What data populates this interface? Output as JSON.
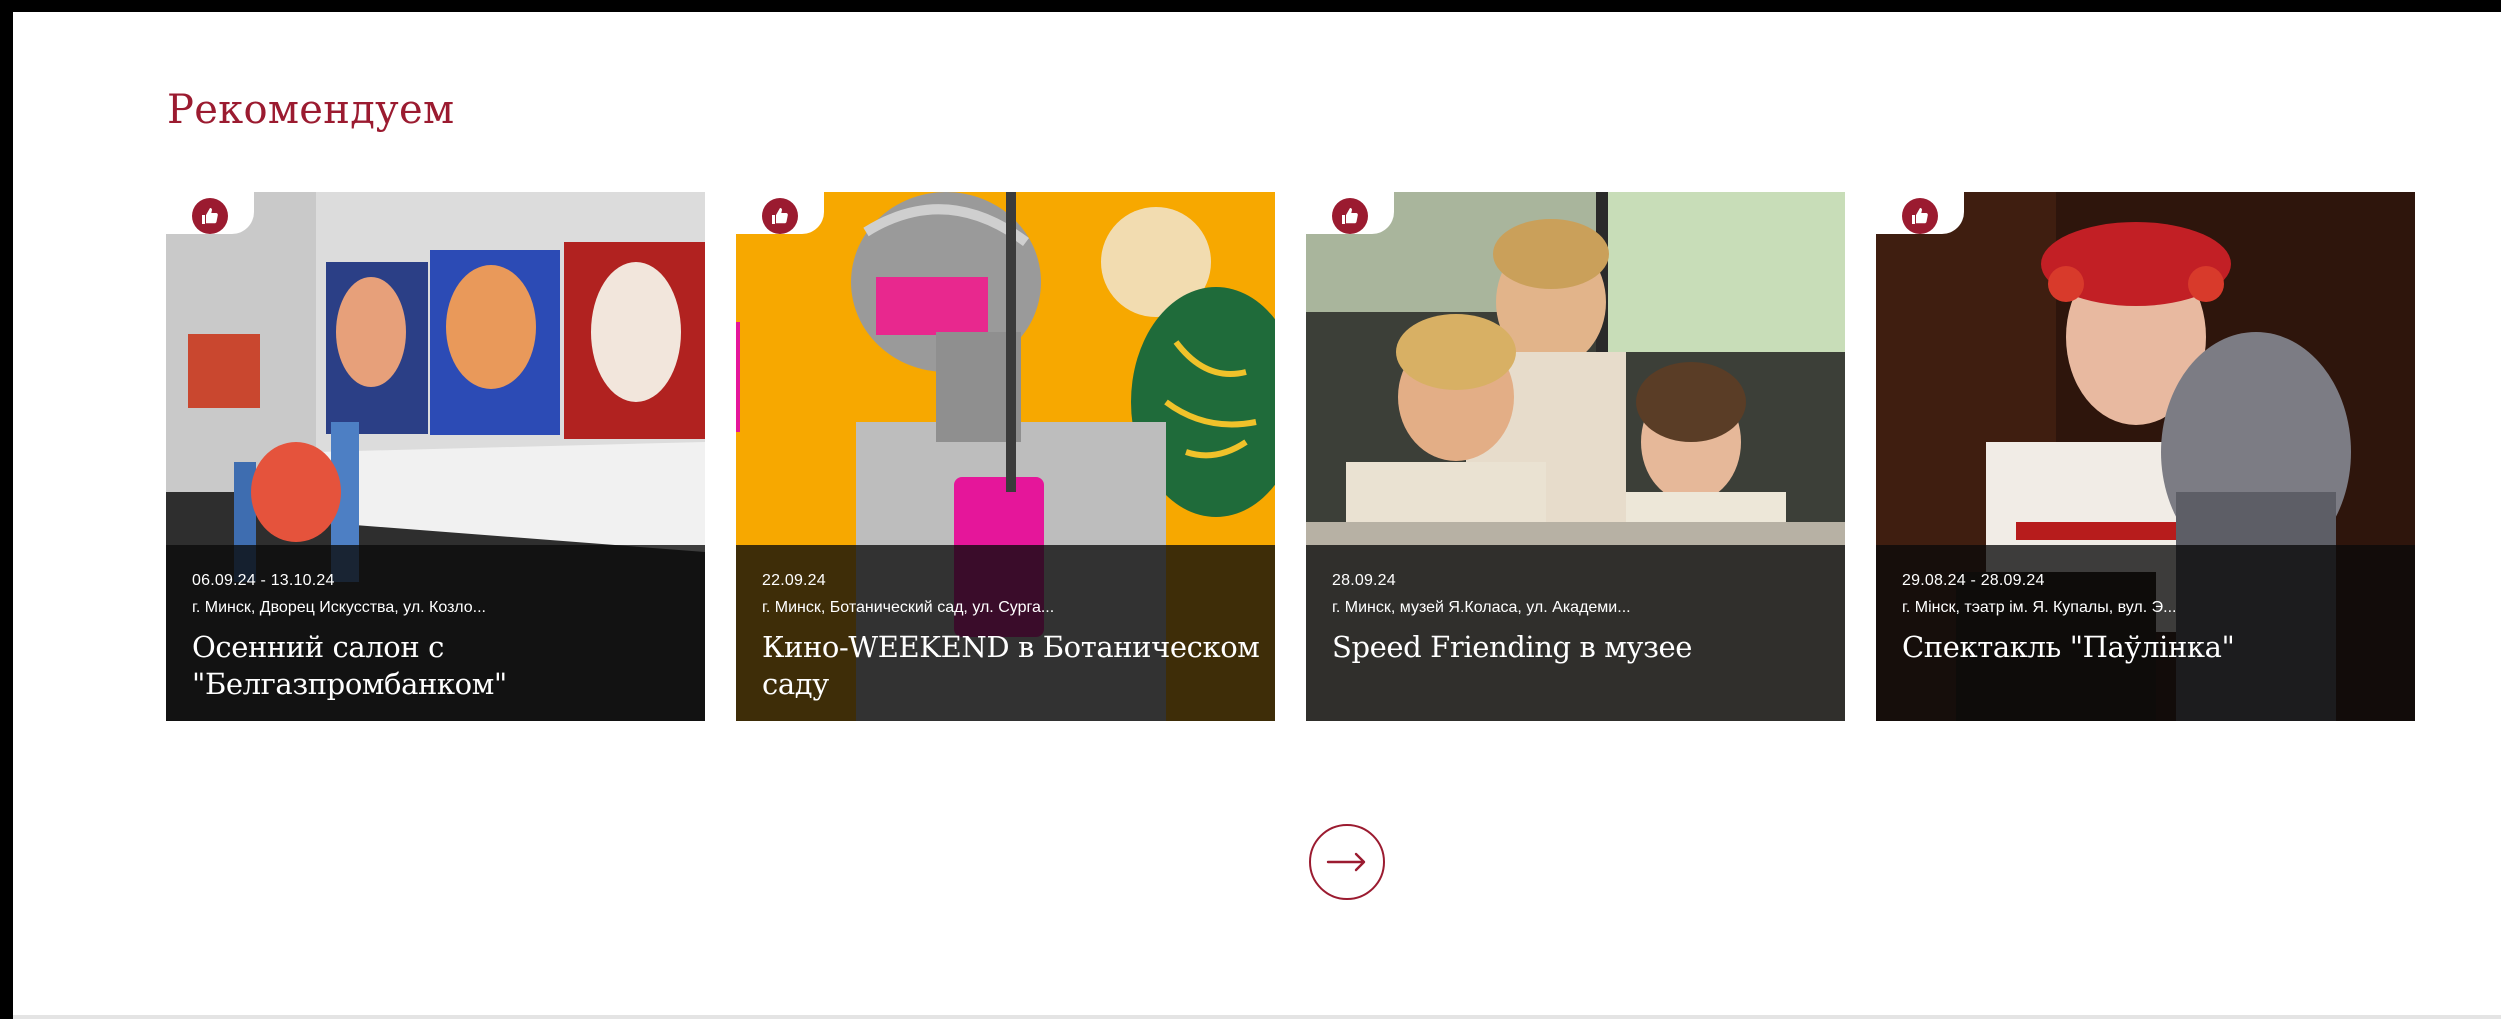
{
  "colors": {
    "accent": "#9b1b30",
    "overlay": "#0a0a0a",
    "page_background": "#ffffff"
  },
  "section": {
    "title": "Рекомендуем"
  },
  "cards": [
    {
      "badge_icon": "thumbs-up-icon",
      "date": "06.09.24 - 13.10.24",
      "place": "г. Минск, Дворец Искусства, ул. Козло...",
      "title": "Осенний салон с \"Белгазпромбанком\""
    },
    {
      "badge_icon": "thumbs-up-icon",
      "date": "22.09.24",
      "place": "г. Минск, Ботанический сад, ул. Сурга...",
      "title": "Кино-WEEKEND в Ботаническом саду"
    },
    {
      "badge_icon": "thumbs-up-icon",
      "date": "28.09.24",
      "place": "г. Минск, музей Я.Коласа, ул. Академи...",
      "title": "Speed Friending в музее"
    },
    {
      "badge_icon": "thumbs-up-icon",
      "date": "29.08.24 - 28.09.24",
      "place": "г. Мінск, тэатр ім. Я. Купалы, вул. Э...",
      "title": "Спектакль \"Паўлінка\""
    }
  ],
  "pagination": {
    "next_icon": "arrow-right-icon"
  }
}
